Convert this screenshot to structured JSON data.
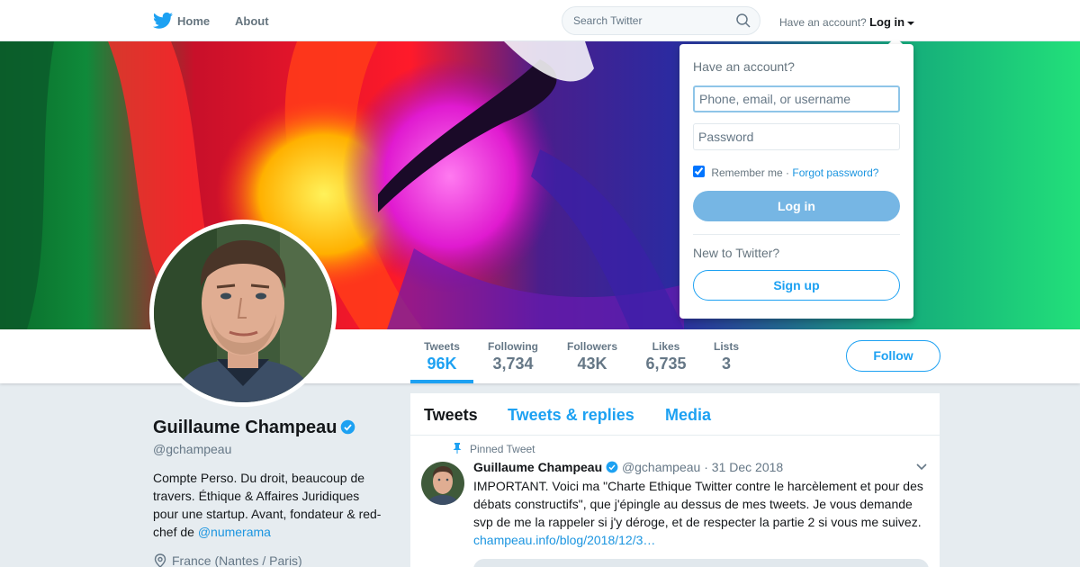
{
  "topbar": {
    "logo_icon": "twitter-bird-icon",
    "home_label": "Home",
    "about_label": "About",
    "search_placeholder": "Search Twitter",
    "have_account": "Have an account?",
    "login_label": "Log in"
  },
  "profile_nav": {
    "stats": [
      {
        "label": "Tweets",
        "value": "96K"
      },
      {
        "label": "Following",
        "value": "3,734"
      },
      {
        "label": "Followers",
        "value": "43K"
      },
      {
        "label": "Likes",
        "value": "6,735"
      },
      {
        "label": "Lists",
        "value": "3"
      }
    ],
    "follow_label": "Follow"
  },
  "profile": {
    "name": "Guillaume Champeau",
    "handle": "@gchampeau",
    "bio_text": "Compte Perso. Du droit, beaucoup de travers. Éthique & Affaires Juridiques pour une startup. Avant, fondateur & red-chef de ",
    "bio_mention": "@numerama",
    "location": "France (Nantes / Paris)"
  },
  "timeline": {
    "tabs": [
      "Tweets",
      "Tweets & replies",
      "Media"
    ],
    "pinned_label": "Pinned Tweet",
    "tweet": {
      "name": "Guillaume Champeau",
      "handle": "@gchampeau",
      "separator": "·",
      "date": "31 Dec 2018",
      "text": "IMPORTANT. Voici ma \"Charte Ethique Twitter contre le harcèlement et pour des débats constructifs\", que j'épingle au dessus de mes tweets. Je vous demande svp de me la rappeler si j'y déroge, et de respecter la partie 2 si vous me suivez.",
      "link": "champeau.info/blog/2018/12/3…"
    }
  },
  "login_dropdown": {
    "title": "Have an account?",
    "username_placeholder": "Phone, email, or username",
    "password_placeholder": "Password",
    "remember_label": "Remember me",
    "separator": "·",
    "forgot_label": "Forgot password?",
    "login_button": "Log in",
    "new_label": "New to Twitter?",
    "signup_button": "Sign up"
  },
  "colors": {
    "accent": "#1da1f2",
    "link": "#1b95e0",
    "background": "#e6ecf0"
  }
}
